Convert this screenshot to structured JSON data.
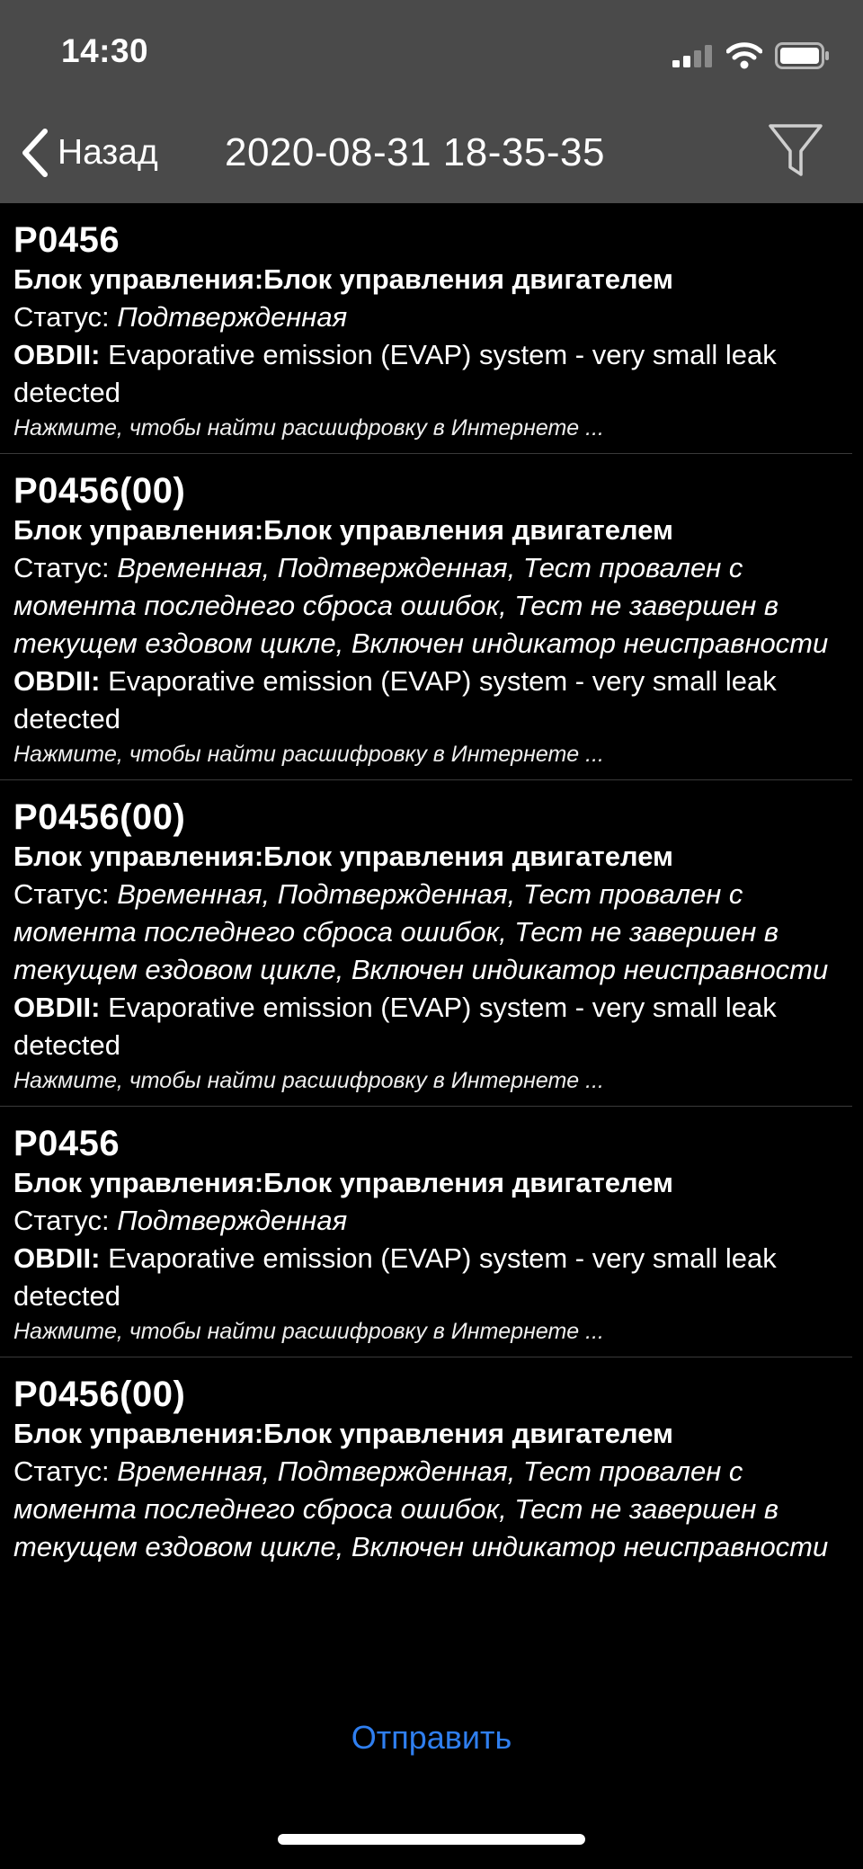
{
  "status_bar": {
    "time": "14:30"
  },
  "nav": {
    "back_label": "Назад",
    "title": "2020-08-31 18-35-35"
  },
  "labels": {
    "status_prefix": "Статус:",
    "obd_prefix": "OBDII:"
  },
  "errors": [
    {
      "code": "P0456",
      "module": "Блок управления:Блок управления двигателем",
      "status": "Подтвержденная",
      "obd": "Evaporative emission (EVAP) system - very small leak detected",
      "hint": "Нажмите, чтобы найти расшифровку в Интернете ..."
    },
    {
      "code": "P0456(00)",
      "module": "Блок управления:Блок управления двигателем",
      "status": "Временная, Подтвержденная, Тест провален с момента последнего сброса ошибок, Тест не завершен в текущем ездовом цикле, Включен индикатор неисправности",
      "obd": "Evaporative emission (EVAP) system - very small leak detected",
      "hint": "Нажмите, чтобы найти расшифровку в Интернете ..."
    },
    {
      "code": "P0456(00)",
      "module": "Блок управления:Блок управления двигателем",
      "status": "Временная, Подтвержденная, Тест провален с момента последнего сброса ошибок, Тест не завершен в текущем ездовом цикле, Включен индикатор неисправности",
      "obd": "Evaporative emission (EVAP) system - very small leak detected",
      "hint": "Нажмите, чтобы найти расшифровку в Интернете ..."
    },
    {
      "code": "P0456",
      "module": "Блок управления:Блок управления двигателем",
      "status": "Подтвержденная",
      "obd": "Evaporative emission (EVAP) system - very small leak detected",
      "hint": "Нажмите, чтобы найти расшифровку в Интернете ..."
    },
    {
      "code": "P0456(00)",
      "module": "Блок управления:Блок управления двигателем",
      "status": "Временная, Подтвержденная, Тест провален с момента последнего сброса ошибок, Тест не завершен в текущем ездовом цикле, Включен индикатор неисправности"
    }
  ],
  "footer": {
    "send_label": "Отправить"
  }
}
